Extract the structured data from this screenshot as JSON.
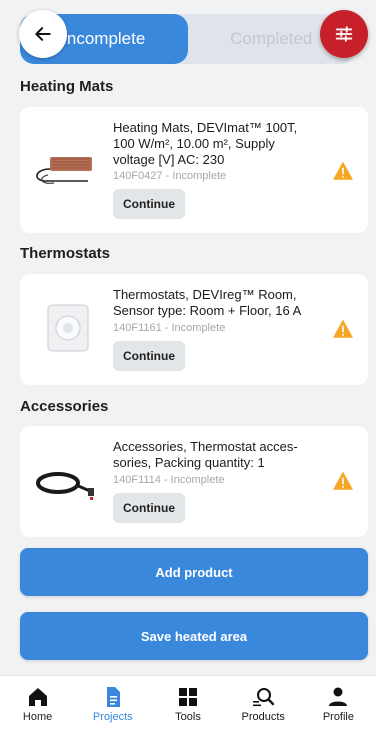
{
  "tabs": {
    "incomplete": "Incomplete",
    "completed": "Completed"
  },
  "sections": [
    {
      "title": "Heating Mats",
      "item": {
        "title": "Heating Mats, DEVImat™ 100T, 100 W/m², 10.00 m², Supply voltage [V] AC: 230",
        "meta": "140F0427 - Incomplete",
        "action": "Continue"
      }
    },
    {
      "title": "Thermostats",
      "item": {
        "title": "Thermostats, DEVIreg™ Room, Sensor type: Room + Floor, 16 A",
        "meta": "140F1161 - Incomplete",
        "action": "Continue"
      }
    },
    {
      "title": "Accessories",
      "item": {
        "title": "Accessories, Thermostat acces-sories, Packing quantity: 1",
        "meta": "140F1114 - Incomplete",
        "action": "Continue"
      }
    }
  ],
  "buttons": {
    "add_product": "Add product",
    "save_area": "Save heated area"
  },
  "nav": {
    "home": "Home",
    "projects": "Projects",
    "tools": "Tools",
    "products": "Products",
    "profile": "Profile"
  },
  "colors": {
    "accent": "#3a88dc",
    "filter": "#c8202b",
    "warning": "#f5a623"
  }
}
